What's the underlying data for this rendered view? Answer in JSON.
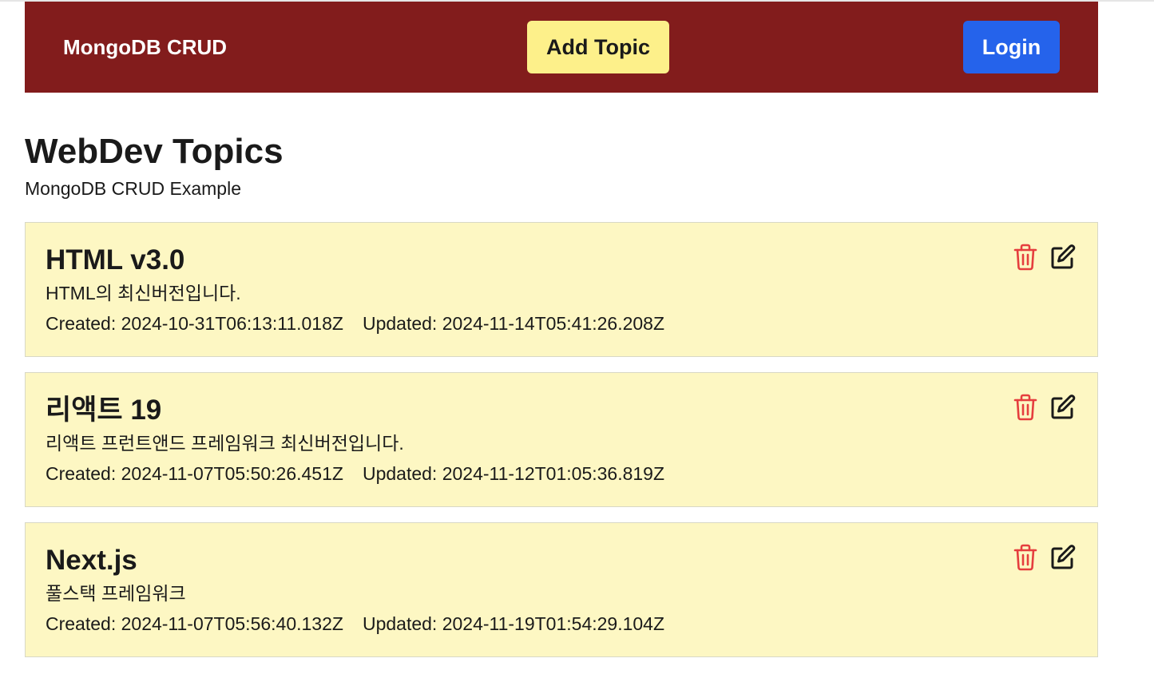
{
  "colors": {
    "navbar_bg": "#821c1c",
    "add_button_bg": "#fdf08a",
    "login_button_bg": "#2563eb",
    "card_bg": "#fdf7c3",
    "delete_icon": "#e53e3e",
    "edit_icon": "#1a1a1a"
  },
  "navbar": {
    "brand": "MongoDB CRUD",
    "add_topic_label": "Add Topic",
    "login_label": "Login"
  },
  "page": {
    "title": "WebDev Topics",
    "subtitle": "MongoDB CRUD Example"
  },
  "topics": [
    {
      "title": "HTML v3.0",
      "description": "HTML의 최신버전입니다.",
      "created": "Created: 2024-10-31T06:13:11.018Z",
      "updated": "Updated: 2024-11-14T05:41:26.208Z",
      "delete_icon": "trash-icon",
      "edit_icon": "edit-icon"
    },
    {
      "title": "리액트 19",
      "description": "리액트 프런트앤드 프레임워크 최신버전입니다.",
      "created": "Created: 2024-11-07T05:50:26.451Z",
      "updated": "Updated: 2024-11-12T01:05:36.819Z",
      "delete_icon": "trash-icon",
      "edit_icon": "edit-icon"
    },
    {
      "title": "Next.js",
      "description": "풀스택 프레임워크",
      "created": "Created: 2024-11-07T05:56:40.132Z",
      "updated": "Updated: 2024-11-19T01:54:29.104Z",
      "delete_icon": "trash-icon",
      "edit_icon": "edit-icon"
    }
  ]
}
